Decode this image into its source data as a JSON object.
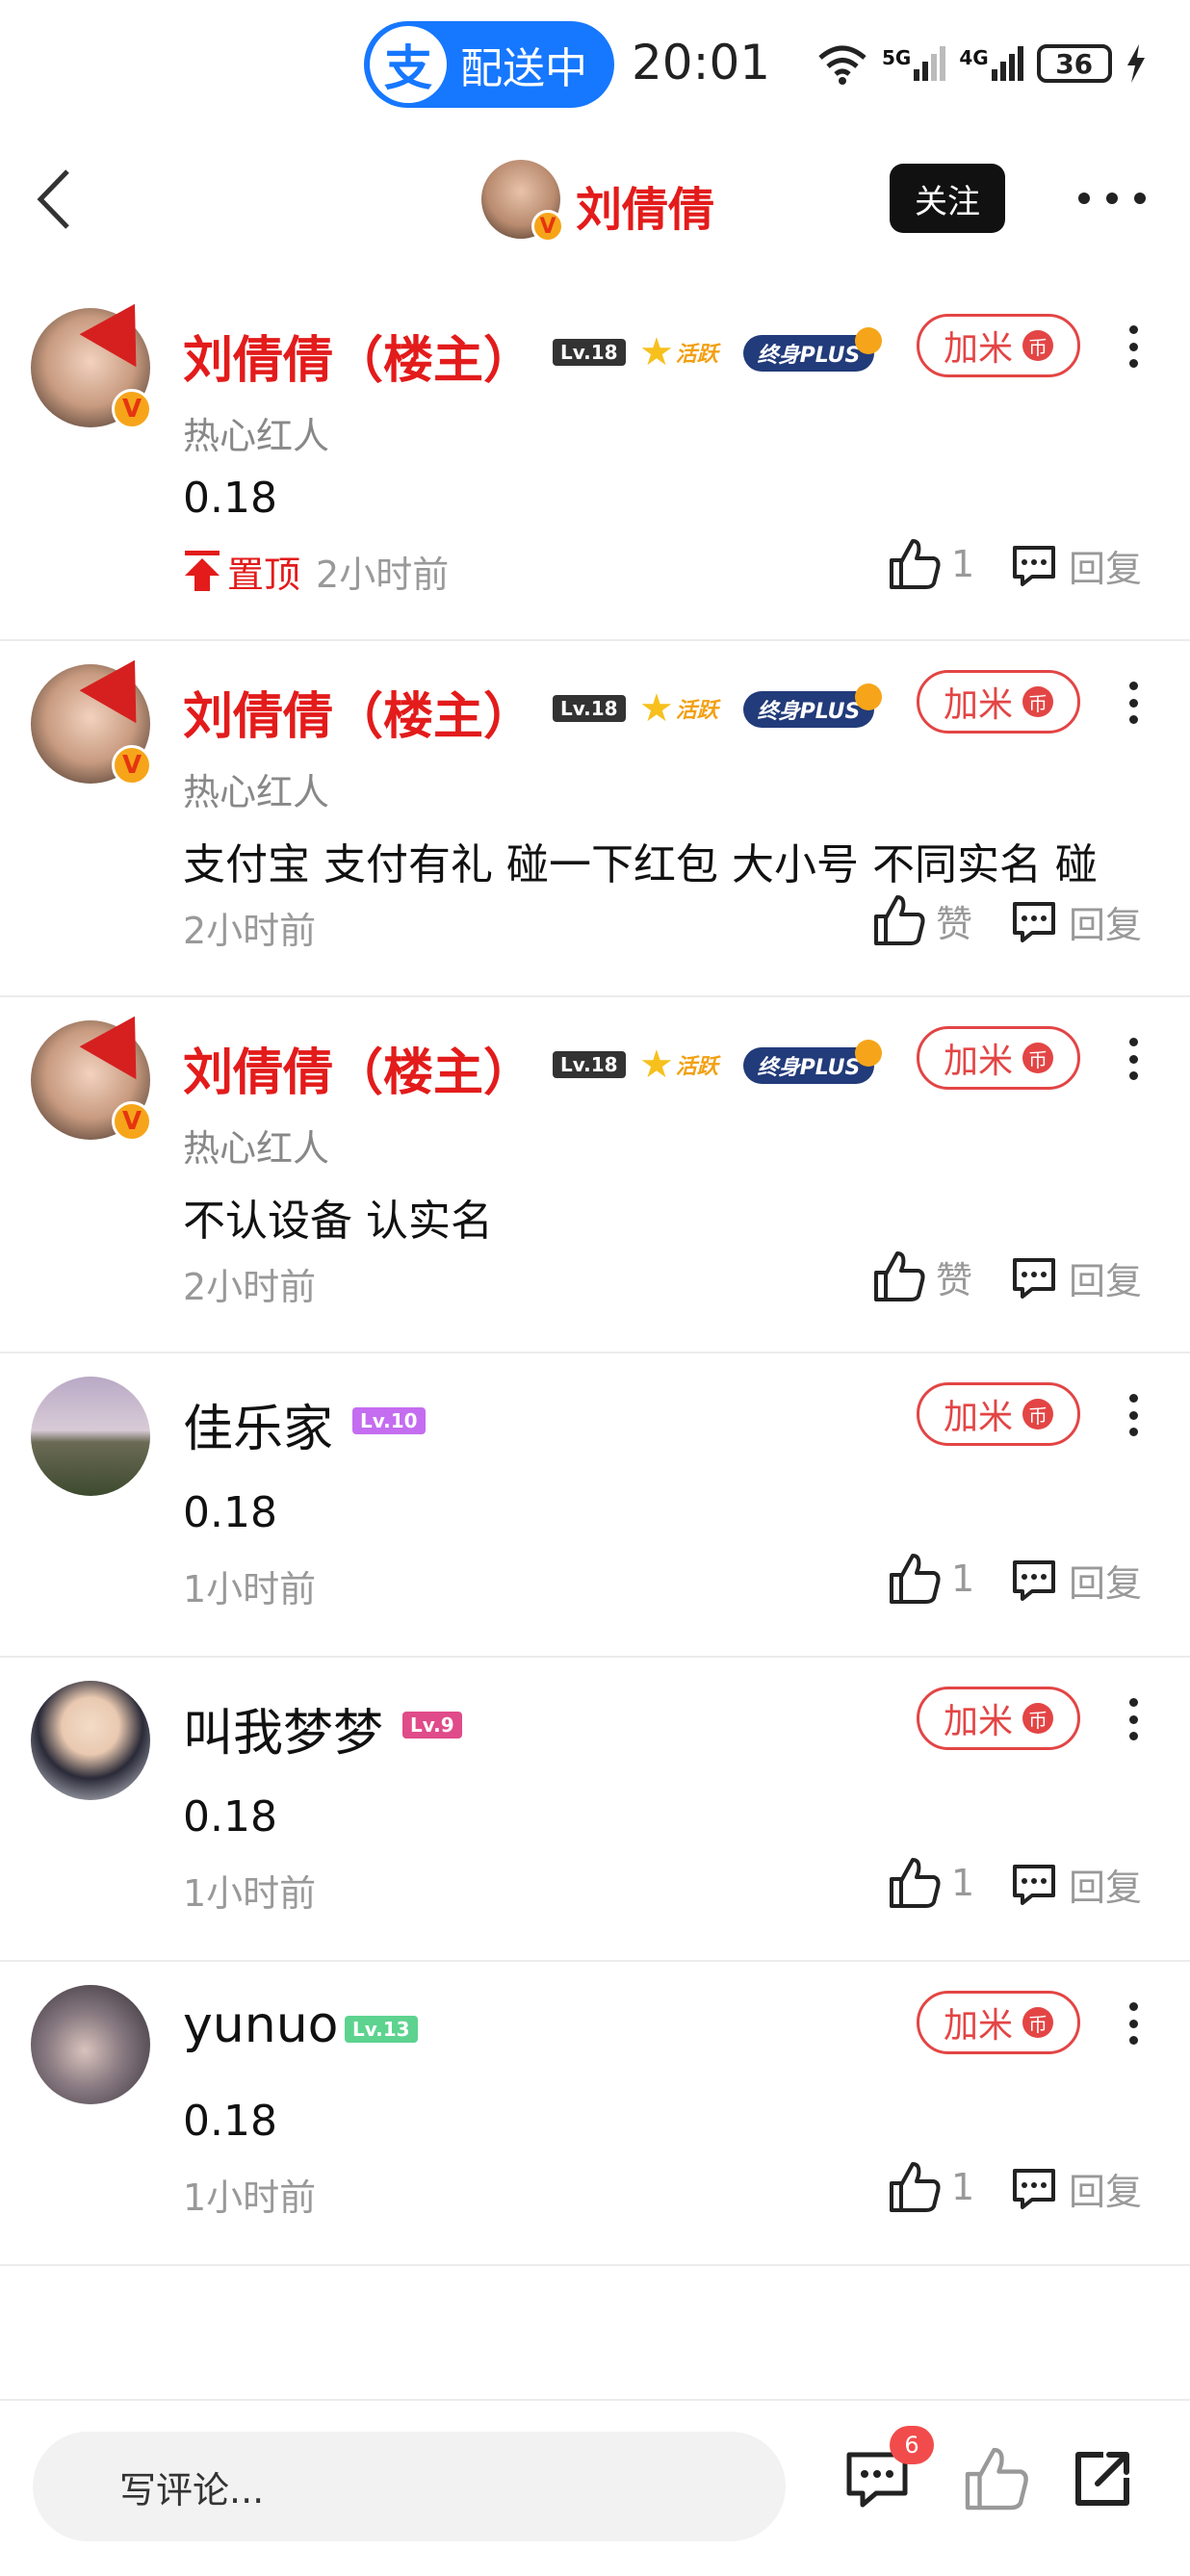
{
  "status_bar": {
    "app_pill_logo": "支",
    "app_pill_text": "配送中",
    "time": "20:01",
    "battery": "36",
    "network_labels": [
      "5G",
      "4G"
    ]
  },
  "header": {
    "title": "刘倩倩",
    "follow_label": "关注"
  },
  "comments": [
    {
      "username": "刘倩倩（楼主）",
      "is_host": true,
      "level": "Lv.18",
      "active_label": "活跃",
      "plus_label": "终身PLUS",
      "subtitle": "热心红人",
      "content": "0.18",
      "pinned_label": "置顶",
      "time": "2小时前",
      "likes": "1",
      "reply_label": "回复",
      "jiami_label": "加米",
      "coin_glyph": "币"
    },
    {
      "username": "刘倩倩（楼主）",
      "is_host": true,
      "level": "Lv.18",
      "active_label": "活跃",
      "plus_label": "终身PLUS",
      "subtitle": "热心红人",
      "content": "支付宝 支付有礼 碰一下红包 大小号 不同实名 碰",
      "time": "2小时前",
      "likes": "赞",
      "reply_label": "回复",
      "jiami_label": "加米",
      "coin_glyph": "币"
    },
    {
      "username": "刘倩倩（楼主）",
      "is_host": true,
      "level": "Lv.18",
      "active_label": "活跃",
      "plus_label": "终身PLUS",
      "subtitle": "热心红人",
      "content": "不认设备 认实名",
      "time": "2小时前",
      "likes": "赞",
      "reply_label": "回复",
      "jiami_label": "加米",
      "coin_glyph": "币"
    },
    {
      "username": "佳乐家",
      "is_host": false,
      "level": "Lv.10",
      "level_color": "#c46df0",
      "content": "0.18",
      "time": "1小时前",
      "likes": "1",
      "reply_label": "回复",
      "jiami_label": "加米",
      "coin_glyph": "币"
    },
    {
      "username": "叫我梦梦",
      "is_host": false,
      "level": "Lv.9",
      "level_color": "#e04b8a",
      "content": "0.18",
      "time": "1小时前",
      "likes": "1",
      "reply_label": "回复",
      "jiami_label": "加米",
      "coin_glyph": "币"
    },
    {
      "username": "yunuo",
      "is_host": false,
      "level": "Lv.13",
      "level_color": "#5dd38f",
      "content": "0.18",
      "time": "1小时前",
      "likes": "1",
      "reply_label": "回复",
      "jiami_label": "加米",
      "coin_glyph": "币"
    }
  ],
  "bottom_bar": {
    "input_placeholder": "写评论...",
    "comment_count": "6"
  },
  "colors": {
    "host_red": "#e31b1b",
    "accent_blue": "#1677ff",
    "jiami_red": "#e34545"
  }
}
